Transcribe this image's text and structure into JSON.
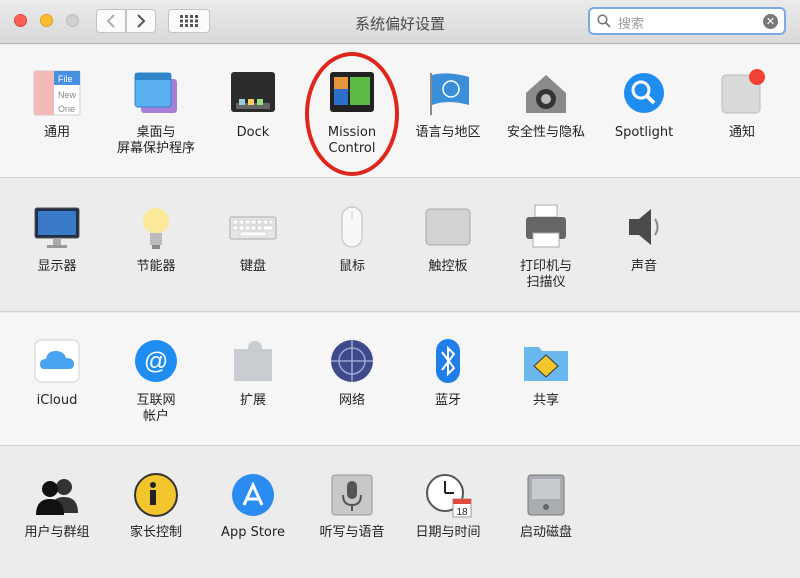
{
  "window": {
    "title": "系统偏好设置"
  },
  "search": {
    "placeholder": "搜索"
  },
  "colors": {
    "accent": "#7aa9e6",
    "annotation_ring": "#e0261b"
  },
  "sections": [
    {
      "items": [
        {
          "label": "通用",
          "icon": "general-icon"
        },
        {
          "label": "桌面与\n屏幕保护程序",
          "icon": "desktop-screensaver-icon"
        },
        {
          "label": "Dock",
          "icon": "dock-icon"
        },
        {
          "label": "Mission\nControl",
          "icon": "mission-control-icon"
        },
        {
          "label": "语言与地区",
          "icon": "language-region-icon"
        },
        {
          "label": "安全性与隐私",
          "icon": "security-privacy-icon"
        },
        {
          "label": "Spotlight",
          "icon": "spotlight-icon"
        },
        {
          "label": "通知",
          "icon": "notifications-icon"
        }
      ]
    },
    {
      "items": [
        {
          "label": "显示器",
          "icon": "displays-icon"
        },
        {
          "label": "节能器",
          "icon": "energy-saver-icon"
        },
        {
          "label": "键盘",
          "icon": "keyboard-icon"
        },
        {
          "label": "鼠标",
          "icon": "mouse-icon"
        },
        {
          "label": "触控板",
          "icon": "trackpad-icon"
        },
        {
          "label": "打印机与\n扫描仪",
          "icon": "printers-scanners-icon"
        },
        {
          "label": "声音",
          "icon": "sound-icon"
        }
      ]
    },
    {
      "items": [
        {
          "label": "iCloud",
          "icon": "icloud-icon"
        },
        {
          "label": "互联网\n帐户",
          "icon": "internet-accounts-icon"
        },
        {
          "label": "扩展",
          "icon": "extensions-icon"
        },
        {
          "label": "网络",
          "icon": "network-icon"
        },
        {
          "label": "蓝牙",
          "icon": "bluetooth-icon"
        },
        {
          "label": "共享",
          "icon": "sharing-icon"
        }
      ]
    },
    {
      "items": [
        {
          "label": "用户与群组",
          "icon": "users-groups-icon"
        },
        {
          "label": "家长控制",
          "icon": "parental-controls-icon"
        },
        {
          "label": "App Store",
          "icon": "app-store-icon"
        },
        {
          "label": "听写与语音",
          "icon": "dictation-speech-icon"
        },
        {
          "label": "日期与时间",
          "icon": "date-time-icon"
        },
        {
          "label": "启动磁盘",
          "icon": "startup-disk-icon"
        }
      ]
    }
  ],
  "icon_text": {
    "file_top": "File",
    "file_mid": "New",
    "file_bot": "One",
    "calendar_day": "18"
  }
}
